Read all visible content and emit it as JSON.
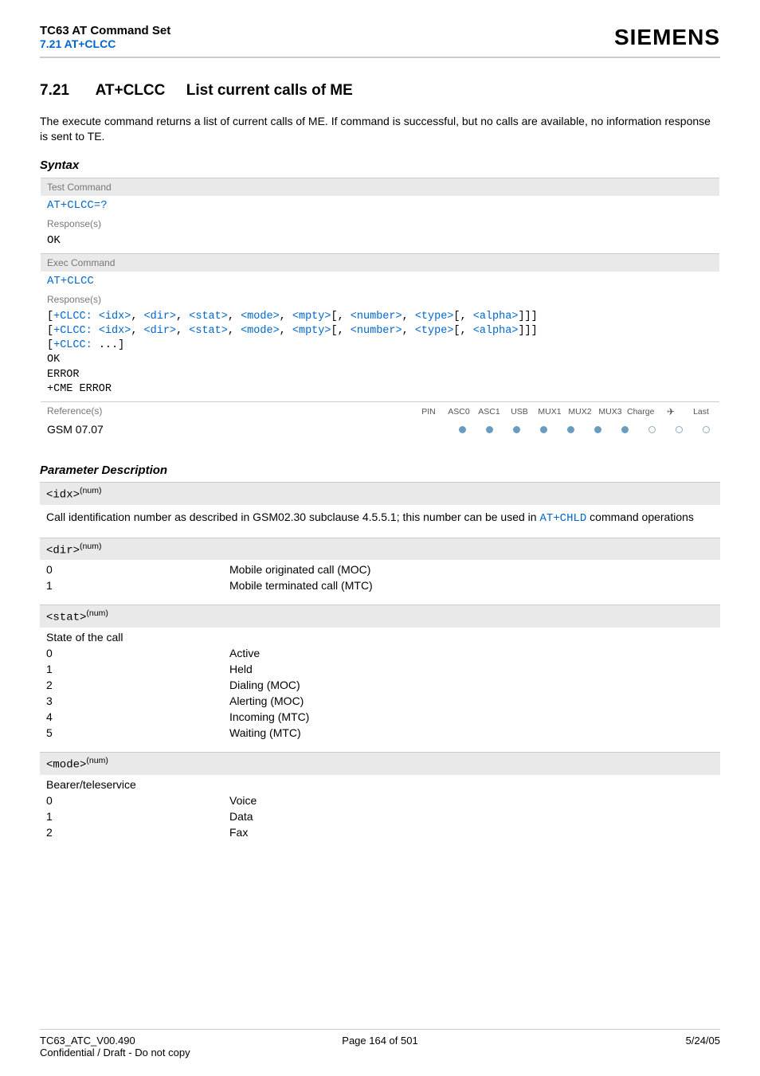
{
  "header": {
    "title": "TC63 AT Command Set",
    "subtitle": "7.21 AT+CLCC",
    "brand": "SIEMENS"
  },
  "section": {
    "number": "7.21",
    "command": "AT+CLCC",
    "title": "List current calls of ME",
    "intro": "The execute command returns a list of current calls of ME. If command is successful, but no calls are available, no information response is sent to TE."
  },
  "syntax": {
    "heading": "Syntax",
    "test_label": "Test Command",
    "test_cmd": "AT+CLCC=?",
    "responses_label": "Response(s)",
    "ok": "OK",
    "exec_label": "Exec Command",
    "exec_cmd": "AT+CLCC",
    "exec_responses": [
      {
        "prefix": "[",
        "cmd": "+CLCC: ",
        "params": "<idx>, <dir>, <stat>, <mode>, <mpty>",
        "opt": "[, ",
        "params2": "<number>, <type>",
        "opt2": "[, ",
        "params3": "<alpha>",
        "suffix": "]]]"
      },
      {
        "prefix": "[",
        "cmd": "+CLCC: ",
        "params": "<idx>, <dir>, <stat>, <mode>, <mpty>",
        "opt": "[, ",
        "params2": "<number>, <type>",
        "opt2": "[, ",
        "params3": "<alpha>",
        "suffix": "]]]"
      }
    ],
    "more_line": "[+CLCC: ...]",
    "ok2": "OK",
    "error": "ERROR",
    "cme": "+CME ERROR",
    "references_label": "Reference(s)",
    "reference_value": "GSM 07.07",
    "chips": [
      "PIN",
      "ASC0",
      "ASC1",
      "USB",
      "MUX1",
      "MUX2",
      "MUX3",
      "Charge",
      "✈",
      "Last"
    ],
    "chip_states": [
      "full",
      "full",
      "full",
      "full",
      "full",
      "full",
      "full",
      "empty",
      "empty",
      "empty"
    ]
  },
  "paramdesc_heading": "Parameter Description",
  "params": [
    {
      "name": "<idx>",
      "sup": "(num)",
      "desc_pre": "Call identification number as described in GSM02.30 subclause 4.5.5.1; this number can be used in ",
      "desc_link": "AT+CHLD",
      "desc_post": " command operations"
    },
    {
      "name": "<dir>",
      "sup": "(num)",
      "rows": [
        {
          "k": "0",
          "v": "Mobile originated call (MOC)"
        },
        {
          "k": "1",
          "v": "Mobile terminated call (MTC)"
        }
      ]
    },
    {
      "name": "<stat>",
      "sup": "(num)",
      "caption": "State of the call",
      "rows": [
        {
          "k": "0",
          "v": "Active"
        },
        {
          "k": "1",
          "v": "Held"
        },
        {
          "k": "2",
          "v": "Dialing (MOC)"
        },
        {
          "k": "3",
          "v": "Alerting (MOC)"
        },
        {
          "k": "4",
          "v": "Incoming (MTC)"
        },
        {
          "k": "5",
          "v": "Waiting (MTC)"
        }
      ]
    },
    {
      "name": "<mode>",
      "sup": "(num)",
      "caption": "Bearer/teleservice",
      "rows": [
        {
          "k": "0",
          "v": "Voice"
        },
        {
          "k": "1",
          "v": "Data"
        },
        {
          "k": "2",
          "v": "Fax"
        }
      ]
    }
  ],
  "footer": {
    "left": "TC63_ATC_V00.490",
    "conf": "Confidential / Draft - Do not copy",
    "mid": "Page 164 of 501",
    "right": "5/24/05"
  }
}
